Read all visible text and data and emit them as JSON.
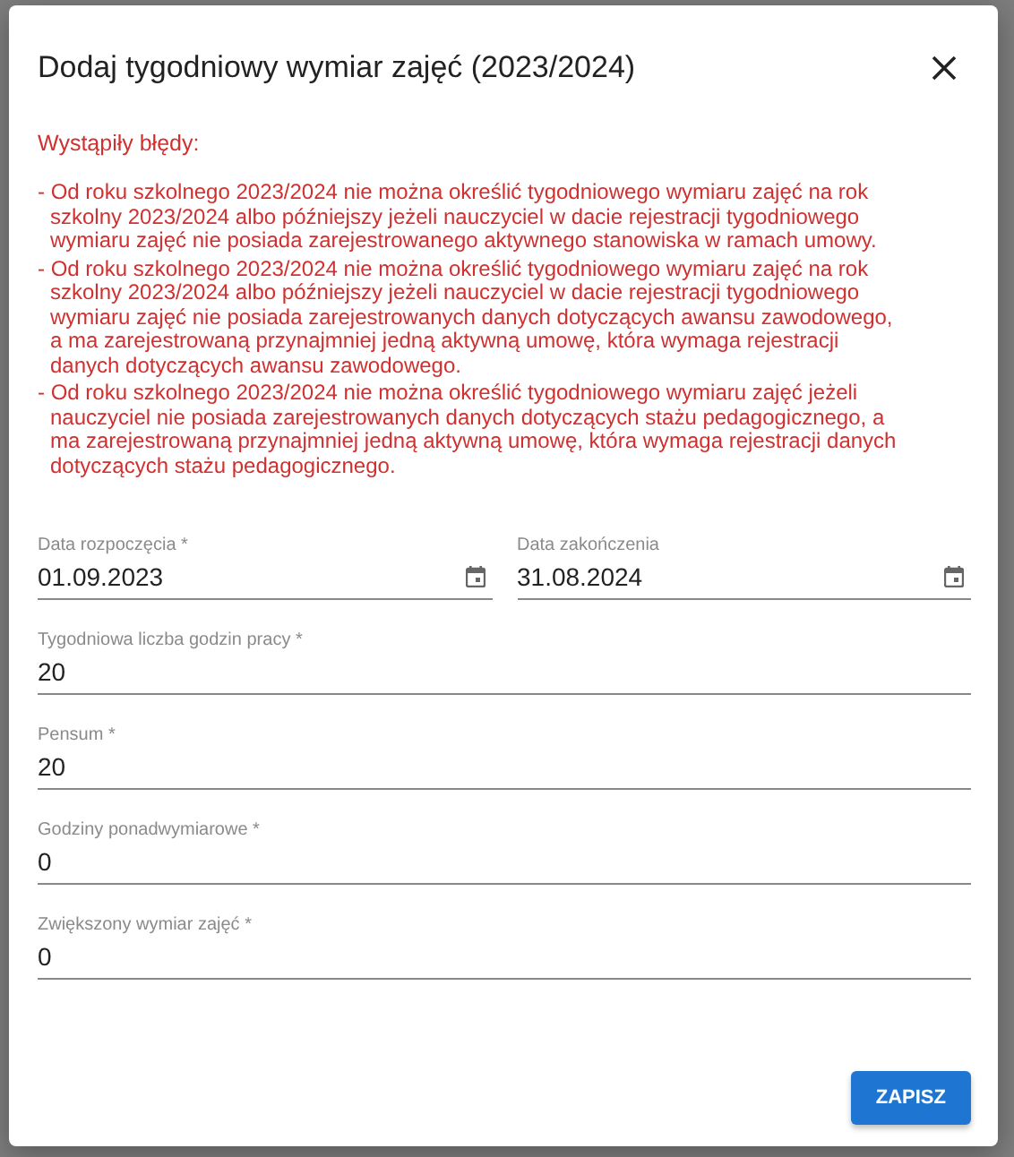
{
  "dialog": {
    "title": "Dodaj tygodniowy wymiar zajęć (2023/2024)",
    "errors_heading": "Wystąpiły błędy:",
    "errors": [
      "- Od roku szkolnego 2023/2024 nie można określić tygodniowego wymiaru zajęć na rok szkolny 2023/2024 albo późniejszy jeżeli nauczyciel w dacie rejestracji tygodniowego wymiaru zajęć nie posiada zarejestrowanego aktywnego stanowiska w ramach umowy.",
      "- Od roku szkolnego 2023/2024 nie można określić tygodniowego wymiaru zajęć na rok szkolny 2023/2024 albo późniejszy jeżeli nauczyciel w dacie rejestracji tygodniowego wymiaru zajęć nie posiada zarejestrowanych danych dotyczących awansu zawodowego, a ma zarejestrowaną przynajmniej jedną aktywną umowę, która wymaga rejestracji danych dotyczących awansu zawodowego.",
      "- Od roku szkolnego 2023/2024 nie można określić tygodniowego wymiaru zajęć jeżeli nauczyciel nie posiada zarejestrowanych danych dotyczących stażu pedagogicznego, a ma zarejestrowaną przynajmniej jedną aktywną umowę, która wymaga rejestracji danych dotyczących stażu pedagogicznego."
    ],
    "date_fields": [
      {
        "label": "Data rozpoczęcia *",
        "value": "01.09.2023"
      },
      {
        "label": "Data zakończenia",
        "value": "31.08.2024"
      }
    ],
    "fields": [
      {
        "label": "Tygodniowa liczba godzin pracy *",
        "value": "20"
      },
      {
        "label": "Pensum *",
        "value": "20"
      },
      {
        "label": "Godziny ponadwymiarowe *",
        "value": "0"
      },
      {
        "label": "Zwiększony wymiar zajęć *",
        "value": "0"
      }
    ],
    "save_button": "ZAPISZ"
  }
}
